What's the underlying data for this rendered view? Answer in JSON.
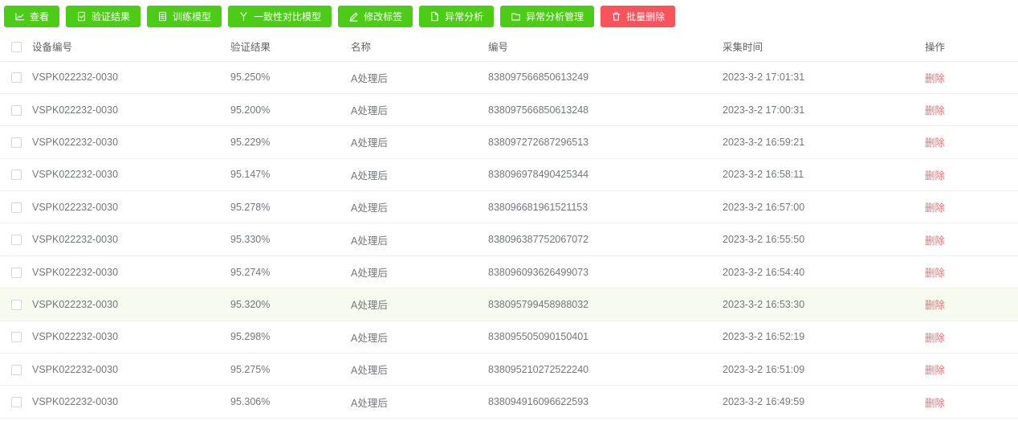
{
  "colors": {
    "button_green": "#4ccb17",
    "button_red": "#f9545b",
    "delete_link_red": "#f56c6c",
    "highlight_row_bg": "#f7faef"
  },
  "toolbar": {
    "buttons": [
      {
        "name": "view-button",
        "label": "查看",
        "icon": "line-chart-icon",
        "style": "green"
      },
      {
        "name": "verify-result-button",
        "label": "验证结果",
        "icon": "doc-check-icon",
        "style": "green"
      },
      {
        "name": "train-model-button",
        "label": "训练模型",
        "icon": "doc-lines-icon",
        "style": "green"
      },
      {
        "name": "consistency-compare-model-button",
        "label": "一致性对比模型",
        "icon": "branch-y-icon",
        "style": "green"
      },
      {
        "name": "edit-label-button",
        "label": "修改标签",
        "icon": "pencil-icon",
        "style": "green"
      },
      {
        "name": "anomaly-analysis-button",
        "label": "异常分析",
        "icon": "file-icon",
        "style": "green"
      },
      {
        "name": "anomaly-analysis-manage-button",
        "label": "异常分析管理",
        "icon": "folder-icon",
        "style": "green"
      },
      {
        "name": "batch-delete-button",
        "label": "批量删除",
        "icon": "trash-icon",
        "style": "red"
      }
    ]
  },
  "table": {
    "headers": {
      "device": "设备编号",
      "result": "验证结果",
      "name": "名称",
      "number": "编号",
      "time": "采集时间",
      "action": "操作"
    },
    "delete_label": "删除",
    "rows": [
      {
        "device": "VSPK022232-0030",
        "result": "95.250%",
        "name": "A处理后",
        "number": "838097566850613249",
        "time": "2023-3-2 17:01:31",
        "highlight": false
      },
      {
        "device": "VSPK022232-0030",
        "result": "95.200%",
        "name": "A处理后",
        "number": "838097566850613248",
        "time": "2023-3-2 17:00:31",
        "highlight": false
      },
      {
        "device": "VSPK022232-0030",
        "result": "95.229%",
        "name": "A处理后",
        "number": "838097272687296513",
        "time": "2023-3-2 16:59:21",
        "highlight": false
      },
      {
        "device": "VSPK022232-0030",
        "result": "95.147%",
        "name": "A处理后",
        "number": "838096978490425344",
        "time": "2023-3-2 16:58:11",
        "highlight": false
      },
      {
        "device": "VSPK022232-0030",
        "result": "95.278%",
        "name": "A处理后",
        "number": "838096681961521153",
        "time": "2023-3-2 16:57:00",
        "highlight": false
      },
      {
        "device": "VSPK022232-0030",
        "result": "95.330%",
        "name": "A处理后",
        "number": "838096387752067072",
        "time": "2023-3-2 16:55:50",
        "highlight": false
      },
      {
        "device": "VSPK022232-0030",
        "result": "95.274%",
        "name": "A处理后",
        "number": "838096093626499073",
        "time": "2023-3-2 16:54:40",
        "highlight": false
      },
      {
        "device": "VSPK022232-0030",
        "result": "95.320%",
        "name": "A处理后",
        "number": "838095799458988032",
        "time": "2023-3-2 16:53:30",
        "highlight": true
      },
      {
        "device": "VSPK022232-0030",
        "result": "95.298%",
        "name": "A处理后",
        "number": "838095505090150401",
        "time": "2023-3-2 16:52:19",
        "highlight": false
      },
      {
        "device": "VSPK022232-0030",
        "result": "95.275%",
        "name": "A处理后",
        "number": "838095210272522240",
        "time": "2023-3-2 16:51:09",
        "highlight": false
      },
      {
        "device": "VSPK022232-0030",
        "result": "95.306%",
        "name": "A处理后",
        "number": "838094916096622593",
        "time": "2023-3-2 16:49:59",
        "highlight": false
      }
    ]
  }
}
